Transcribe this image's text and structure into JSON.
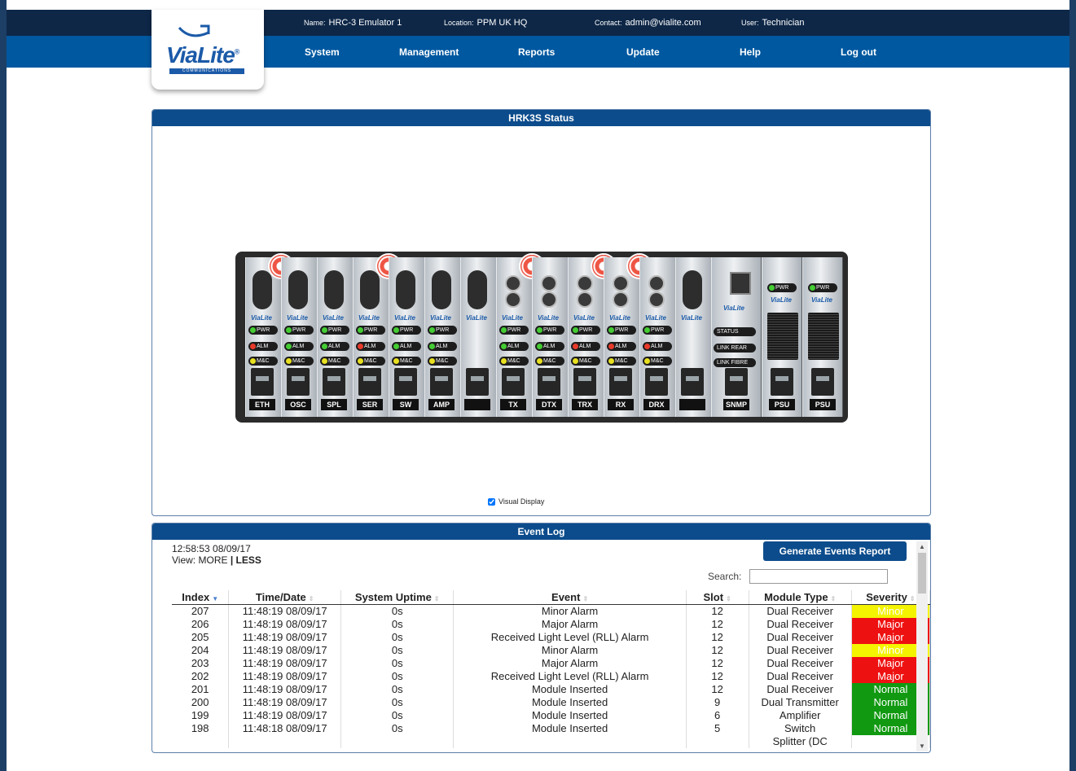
{
  "header": {
    "name_label": "Name:",
    "name_value": "HRC-3 Emulator 1",
    "location_label": "Location:",
    "location_value": "PPM UK HQ",
    "contact_label": "Contact:",
    "contact_value": "admin@vialite.com",
    "user_label": "User:",
    "user_value": "Technician"
  },
  "logo": {
    "brand": "ViaLite",
    "tagline": "COMMUNICATIONS",
    "mark": "®"
  },
  "menu": {
    "items": [
      "System",
      "Management",
      "Reports",
      "Update",
      "Help",
      "Log out"
    ]
  },
  "status_panel": {
    "title": "HRK3S Status",
    "visual_display_label": "Visual Display",
    "visual_display_checked": true
  },
  "rack": {
    "logo_text": "ViaLite",
    "leds": {
      "pwr": "PWR",
      "alm": "ALM",
      "mc": "M&C",
      "status": "STATUS",
      "link_rear": "LINK REAR",
      "link_fibre": "LINK FIBRE"
    },
    "modules": [
      {
        "label": "ETH",
        "gear": true,
        "alm": "#e83a2a"
      },
      {
        "label": "OSC",
        "gear": false,
        "alm": "#44cc33"
      },
      {
        "label": "SPL",
        "gear": false,
        "alm": "#44cc33"
      },
      {
        "label": "SER",
        "gear": true,
        "alm": "#e83a2a"
      },
      {
        "label": "SW",
        "gear": false,
        "alm": "#44cc33"
      },
      {
        "label": "AMP",
        "gear": false,
        "alm": "#44cc33"
      },
      {
        "label": "",
        "gear": false,
        "alm": ""
      },
      {
        "label": "TX",
        "gear": true,
        "alm": "#44cc33"
      },
      {
        "label": "DTX",
        "gear": false,
        "alm": "#44cc33"
      },
      {
        "label": "TRX",
        "gear": true,
        "alm": "#e83a2a"
      },
      {
        "label": "RX",
        "gear": true,
        "alm": "#e83a2a"
      },
      {
        "label": "DRX",
        "gear": false,
        "alm": "#e83a2a"
      },
      {
        "label": "",
        "gear": false,
        "alm": ""
      }
    ],
    "snmp_label": "SNMP",
    "psu_labels": [
      "PSU",
      "PSU"
    ]
  },
  "event_log": {
    "title": "Event Log",
    "timestamp": "12:58:53 08/09/17",
    "view_label": "View:",
    "view_more": "MORE",
    "view_sep": "|",
    "view_less": "LESS",
    "generate_button": "Generate Events Report",
    "search_label": "Search:",
    "search_value": "",
    "columns": [
      "Index",
      "Time/Date",
      "System Uptime",
      "Event",
      "Slot",
      "Module Type",
      "Severity"
    ],
    "rows": [
      [
        "207",
        "11:48:19 08/09/17",
        "0s",
        "Minor Alarm",
        "12",
        "Dual Receiver",
        "Minor"
      ],
      [
        "206",
        "11:48:19 08/09/17",
        "0s",
        "Major Alarm",
        "12",
        "Dual Receiver",
        "Major"
      ],
      [
        "205",
        "11:48:19 08/09/17",
        "0s",
        "Received Light Level (RLL) Alarm",
        "12",
        "Dual Receiver",
        "Major"
      ],
      [
        "204",
        "11:48:19 08/09/17",
        "0s",
        "Minor Alarm",
        "12",
        "Dual Receiver",
        "Minor"
      ],
      [
        "203",
        "11:48:19 08/09/17",
        "0s",
        "Major Alarm",
        "12",
        "Dual Receiver",
        "Major"
      ],
      [
        "202",
        "11:48:19 08/09/17",
        "0s",
        "Received Light Level (RLL) Alarm",
        "12",
        "Dual Receiver",
        "Major"
      ],
      [
        "201",
        "11:48:19 08/09/17",
        "0s",
        "Module Inserted",
        "12",
        "Dual Receiver",
        "Normal"
      ],
      [
        "200",
        "11:48:19 08/09/17",
        "0s",
        "Module Inserted",
        "9",
        "Dual Transmitter",
        "Normal"
      ],
      [
        "199",
        "11:48:19 08/09/17",
        "0s",
        "Module Inserted",
        "6",
        "Amplifier",
        "Normal"
      ],
      [
        "198",
        "11:48:18 08/09/17",
        "0s",
        "Module Inserted",
        "5",
        "Switch",
        "Normal"
      ],
      [
        "",
        "",
        "",
        "",
        "",
        "Splitter (DC",
        ""
      ]
    ],
    "severity_colors": {
      "Minor": "#f4f400",
      "Major": "#ee1111",
      "Normal": "#119911"
    }
  }
}
